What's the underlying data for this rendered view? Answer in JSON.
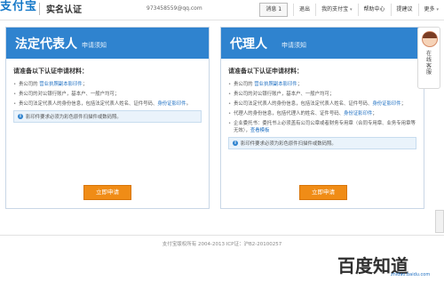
{
  "brand": {
    "logo": "支付宝",
    "page_title": "实名认证"
  },
  "user": {
    "email": "973458559@qq.com"
  },
  "nav": {
    "items": [
      {
        "label": "消息 1",
        "caret": ""
      },
      {
        "label": "退出",
        "caret": ""
      },
      {
        "label": "我的支付宝",
        "caret": "▾"
      },
      {
        "label": "帮助中心",
        "caret": ""
      },
      {
        "label": "提建议",
        "caret": ""
      },
      {
        "label": "更多",
        "caret": "▾"
      }
    ]
  },
  "panels": {
    "left": {
      "title": "法定代表人",
      "subtitle": "申请须知",
      "req_title": "请准备以下认证申请材料：",
      "items": [
        {
          "text": "贵公司的 ",
          "link": "营业执照副本影印件",
          "tail": "；"
        },
        {
          "text": "贵公司的对公银行账户，基本户、一般户均可；",
          "link": "",
          "tail": ""
        },
        {
          "text": "贵公司法定代表人的身份信息，包括法定代表人姓名、证件号码、",
          "link": "身份证影印件",
          "tail": "。"
        }
      ],
      "notice": "影印件要求必须为彩色原件扫描件或数码照。",
      "button": "立即申请"
    },
    "right": {
      "title": "代理人",
      "subtitle": "申请须知",
      "req_title": "请准备以下认证申请材料：",
      "items": [
        {
          "text": "贵公司的 ",
          "link": "营业执照副本影印件",
          "tail": "；"
        },
        {
          "text": "贵公司的对公银行账户，基本户、一般户均可；",
          "link": "",
          "tail": ""
        },
        {
          "text": "贵公司法定代表人的身份信息，包括法定代表人姓名、证件号码、",
          "link": "身份证影印件",
          "tail": "；"
        },
        {
          "text": "代理人的身份信息，包括代理人的姓名、证件号码、",
          "link": "身份证影印件",
          "tail": "；"
        },
        {
          "text": "企业委托书：委托书上必须盖有公司公章或者财务专用章（合同专用章、业务专用章等无效），",
          "link": "查看模板",
          "tail": ""
        }
      ],
      "notice": "影印件要求必须为彩色原件扫描件或数码照。",
      "button": "立即申请"
    }
  },
  "footer": {
    "copyright": "支付宝版权所有 2004-2013 ICP证：沪B2-20100257"
  },
  "side_widget": {
    "label": "在线客服"
  },
  "watermark": {
    "text": "百度知道",
    "url": "zhidao.baidu.com"
  },
  "colors": {
    "header_blue": "#2f83cf",
    "button_orange": "#f08c16",
    "link_blue": "#1e6fc2"
  },
  "icons": [
    "info-icon",
    "caret-down-icon",
    "avatar-icon"
  ]
}
